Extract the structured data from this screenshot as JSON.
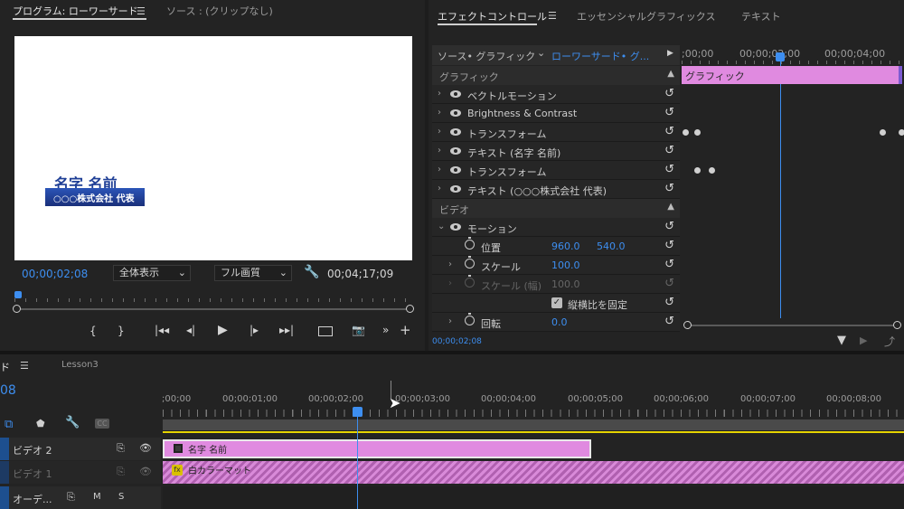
{
  "program_monitor": {
    "tab_program": "プログラム: ローワーサード",
    "tab_source": "ソース : (クリップなし)",
    "title_main": "名字 名前",
    "title_sub": "○○○株式会社 代表",
    "current_time": "00;00;02;08",
    "zoom_select": "全体表示",
    "quality_select": "フル画質",
    "duration": "00;04;17;09"
  },
  "effect_controls": {
    "tab_effect": "エフェクトコントロール",
    "tab_essential": "エッセンシャルグラフィックス",
    "tab_text": "テキスト",
    "source_label": "ソース• グラフィック",
    "clip_label": "ローワーサード• グ...",
    "section_graphic": "グラフィック",
    "section_video": "ビデオ",
    "rows": [
      {
        "label": "ベクトルモーション"
      },
      {
        "label": "Brightness & Contrast"
      },
      {
        "label": "トランスフォーム"
      },
      {
        "label": "テキスト (名字 名前)"
      },
      {
        "label": "トランスフォーム"
      },
      {
        "label": "テキスト (○○○株式会社 代表)"
      }
    ],
    "motion_label": "モーション",
    "position_label": "位置",
    "position_x": "960.0",
    "position_y": "540.0",
    "scale_label": "スケール",
    "scale_value": "100.0",
    "scale_width_label": "スケール (幅)",
    "scale_width_value": "100.0",
    "uniform_scale_label": "縦横比を固定",
    "rotation_label": "回転",
    "rotation_value": "0.0",
    "footer_time": "00;00;02;08",
    "ruler_labels": [
      ";00;00",
      "00;00;02;00",
      "00;00;04;00"
    ],
    "graphic_bar_label": "グラフィック"
  },
  "timeline": {
    "tab_partial": "ド",
    "tab_lesson": "Lesson3",
    "time_partial": "08",
    "ruler_labels": [
      ";00;00",
      "00;00;01;00",
      "00;00;02;00",
      "00;00;03;00",
      "00;00;04;00",
      "00;00;05;00",
      "00;00;06;00",
      "00;00;07;00",
      "00;00;08;00"
    ],
    "tracks": [
      {
        "name": "ビデオ 2"
      },
      {
        "name": "ビデオ 1"
      },
      {
        "name": "オーデ..."
      }
    ],
    "audio_m": "M",
    "audio_s": "S",
    "clip_top": "名字 名前",
    "clip_bottom": "白カラーマット",
    "fx_badge": "fx"
  },
  "colors": {
    "accent_blue": "#3d8ef0",
    "clip_pink": "#e08ae0",
    "title_box_blue": "#1f3f96"
  }
}
